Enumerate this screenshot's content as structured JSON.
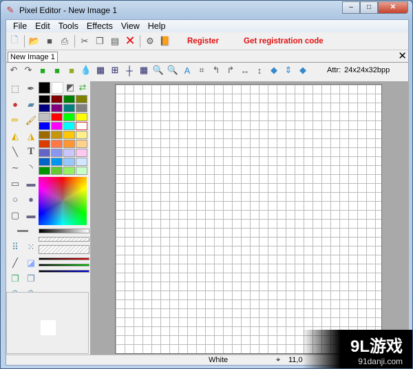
{
  "window": {
    "title": "Pixel Editor - New Image 1",
    "min": "–",
    "max": "□",
    "close": "✕"
  },
  "menu": [
    "File",
    "Edit",
    "Tools",
    "Effects",
    "View",
    "Help"
  ],
  "toolbar": {
    "register": "Register",
    "get_code": "Get registration code"
  },
  "tab": {
    "label": "New Image 1",
    "close": "✕"
  },
  "toolbar2": {
    "attr_label": "Attr:",
    "attr_value": "24x24x32bpp"
  },
  "palette": [
    "#000000",
    "#800000",
    "#008000",
    "#808000",
    "#000080",
    "#800080",
    "#008080",
    "#808080",
    "#c0c0c0",
    "#ff0000",
    "#00ff00",
    "#ffff00",
    "#0000ff",
    "#ff00ff",
    "#00ffff",
    "#ffffff",
    "#9c6a00",
    "#c8960a",
    "#ffc800",
    "#fff08c",
    "#dc3c00",
    "#ff7846",
    "#ff9632",
    "#ffd28c",
    "#6464c8",
    "#8c96f0",
    "#c8c8ff",
    "#ffc8f0",
    "#0064c8",
    "#0096f0",
    "#96c8ff",
    "#d2e6ff",
    "#009600",
    "#64c832",
    "#96f064",
    "#c8ffc8"
  ],
  "status": {
    "color_name": "White",
    "coords": "11,0"
  },
  "watermark": {
    "logo": "9L游戏",
    "site": "91danji.com"
  }
}
